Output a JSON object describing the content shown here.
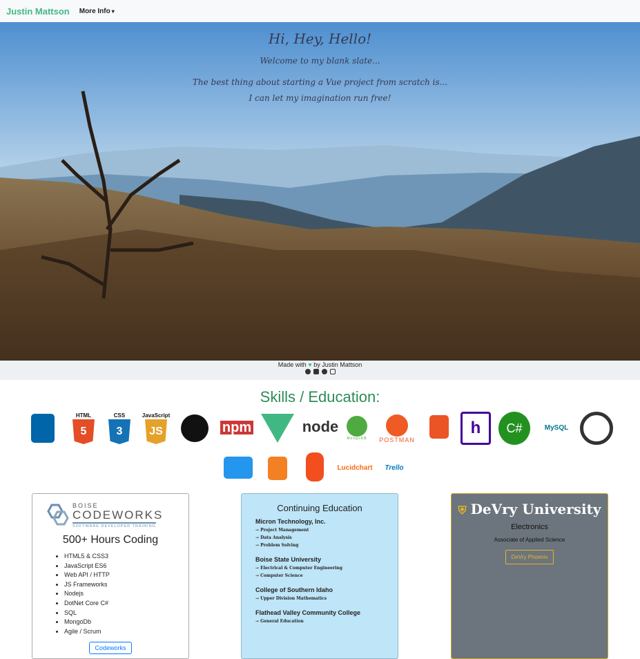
{
  "nav": {
    "brand": "Justin Mattson",
    "more": "More Info",
    "caret": "▾"
  },
  "hero": {
    "line1": "Hi, Hey, Hello!",
    "line2": "Welcome to my blank slate...",
    "line3": "The best thing about starting a Vue project from scratch is...",
    "line4": "I can let my imagination run free!"
  },
  "footer": {
    "made_prefix": "Made with",
    "heart": "♥",
    "made_suffix": "by Justin Mattson"
  },
  "skills": {
    "title": "Skills / Education:",
    "logos": [
      {
        "label": "",
        "icon": "vscode-icon",
        "color": "#0065a9"
      },
      {
        "label": "HTML",
        "num": "5",
        "icon": "html5-icon",
        "color": "#e44d26"
      },
      {
        "label": "CSS",
        "num": "3",
        "icon": "css3-icon",
        "color": "#1572b6"
      },
      {
        "label": "JavaScript",
        "num": "JS",
        "icon": "javascript-icon",
        "color": "#e5a228"
      },
      {
        "label": "",
        "icon": "github-icon",
        "color": "#111111"
      },
      {
        "label": "npm",
        "icon": "npm-icon",
        "color": "#cb3837"
      },
      {
        "label": "",
        "icon": "vue-icon",
        "color": "#41b883"
      },
      {
        "label": "node",
        "icon": "nodejs-icon",
        "color": "#333333"
      },
      {
        "label": "MongoDB",
        "icon": "mongodb-icon",
        "color": "#4faa41"
      },
      {
        "label": "POSTMAN",
        "icon": "postman-icon",
        "color": "#ef5b25"
      },
      {
        "label": "",
        "icon": "auth0-icon",
        "color": "#eb5424"
      },
      {
        "label": "",
        "icon": "heroku-icon",
        "color": "#430098"
      },
      {
        "label": "C#",
        "icon": "csharp-icon",
        "color": "#239120"
      },
      {
        "label": "MySQL",
        "icon": "mysql-icon",
        "color": "#00758f"
      },
      {
        "label": "",
        "icon": "speedometer-icon",
        "color": "#333333"
      },
      {
        "label": "",
        "icon": "docker-icon",
        "color": "#2496ed"
      },
      {
        "label": "",
        "icon": "stackoverflow-icon",
        "color": "#f48024"
      },
      {
        "label": "",
        "icon": "figma-icon",
        "color": "#f24e1e"
      },
      {
        "label": "Lucidchart",
        "icon": "lucidchart-icon",
        "color": "#f96b13"
      },
      {
        "label": "Trello",
        "icon": "trello-icon",
        "color": "#0079bf"
      }
    ]
  },
  "card1": {
    "logo_top": "BOISE",
    "logo_main": "CODEWORKS",
    "logo_sub": "SOFTWARE DEVELOPER TRAINING",
    "hours": "500+ Hours Coding",
    "items": [
      "HTML5 & CSS3",
      "JavaScript ES6",
      "Web API / HTTP",
      "JS Frameworks",
      "Nodejs",
      "DotNet Core C#",
      "SQL",
      "MongoDb",
      "Agile / Scrum"
    ],
    "button": "Codeworks"
  },
  "card2": {
    "title": "Continuing Education",
    "orgs": [
      {
        "name": "Micron Technology, Inc.",
        "items": [
          "→ Project Management",
          "→ Data Analysis",
          "→ Problem Solving"
        ]
      },
      {
        "name": "Boise State University",
        "items": [
          "→ Electrical & Computer Engineering",
          "→ Computer Science"
        ]
      },
      {
        "name": "College of Southern Idaho",
        "items": [
          "→ Upper Division Mathematics"
        ]
      },
      {
        "name": "Flathead Valley Community College",
        "items": [
          "→ General Education"
        ]
      }
    ]
  },
  "card3": {
    "name": "DeVry University",
    "subject": "Electronics",
    "degree": "Associate of Applied Science",
    "button": "DeVry Phoenix"
  }
}
